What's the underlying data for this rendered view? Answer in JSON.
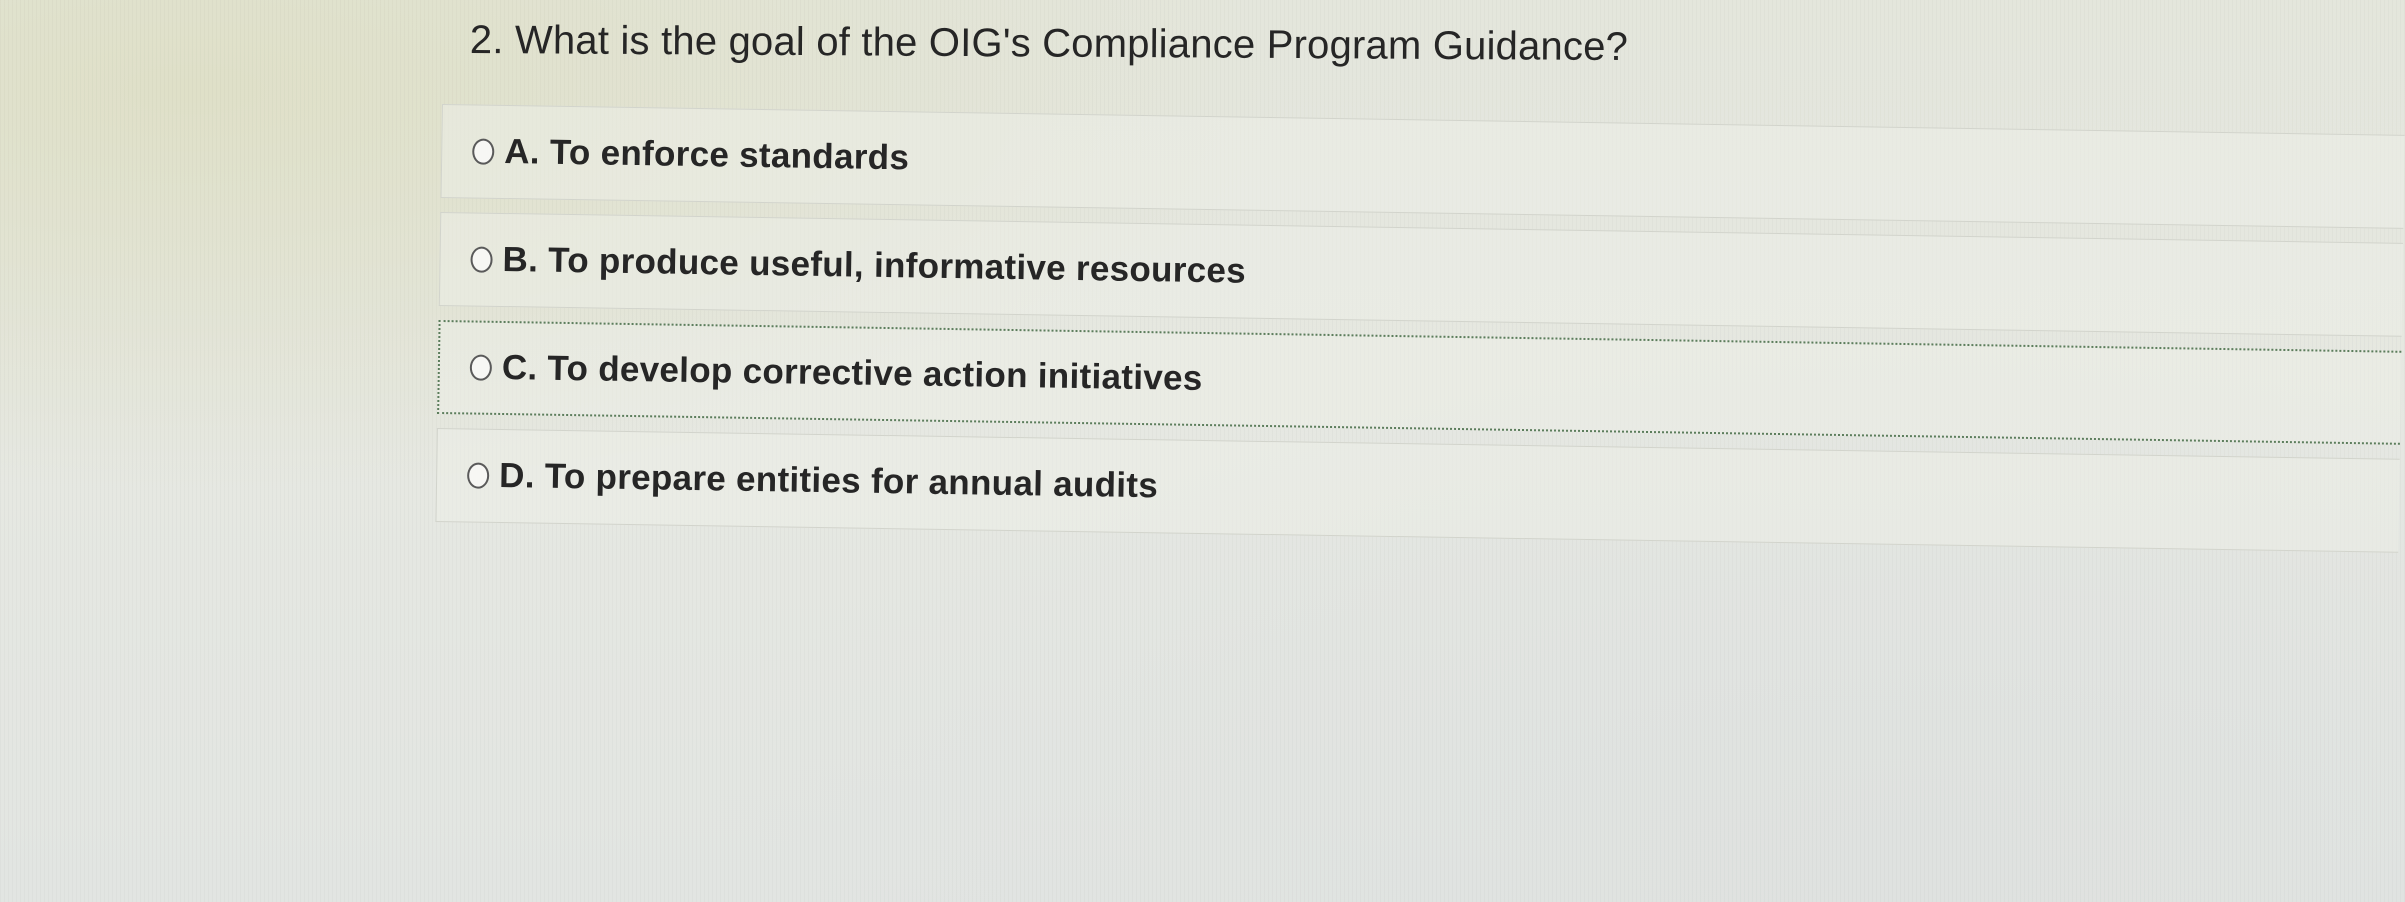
{
  "question": {
    "number": "2.",
    "text": "What is the goal of the OIG's Compliance Program Guidance?"
  },
  "options": [
    {
      "label": "A. To enforce standards",
      "selected": false
    },
    {
      "label": "B. To produce useful, informative resources",
      "selected": false
    },
    {
      "label": "C. To develop corrective action initiatives",
      "selected": false,
      "focused": true
    },
    {
      "label": "D.  To prepare entities for annual audits",
      "selected": false
    }
  ]
}
